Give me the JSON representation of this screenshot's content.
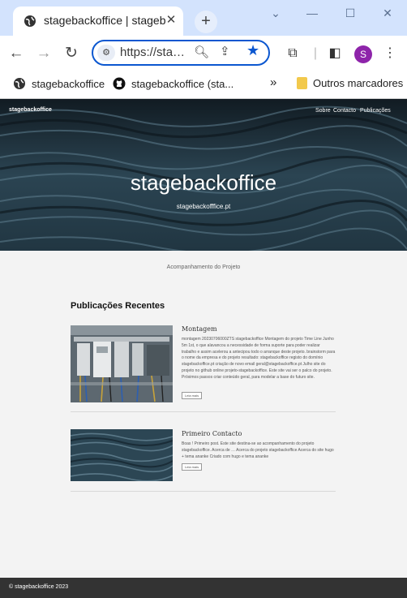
{
  "browser": {
    "tab_title": "stagebackoffice | stagebackoffice",
    "url": "https://stagebackoffice.pt",
    "profile_initial": "S",
    "bookmarks": [
      {
        "label": "stagebackoffice"
      },
      {
        "label": "stagebackoffice (sta..."
      }
    ],
    "other_bookmarks": "Outros marcadores"
  },
  "site": {
    "brand": "stagebackoffice",
    "menu": [
      "Sobre",
      "Contacto",
      "Publicações"
    ],
    "hero_title": "stagebackoffice",
    "hero_subtitle": "stagebackofffice.pt",
    "tagline": "Acompanhamento do Projeto",
    "section_title": "Publicações Recentes",
    "posts": [
      {
        "title": "Montagem",
        "excerpt": "montagem 20230706000ZTS stagebackoffice Montagem do projeto Time Line Junho 5m 1st, o que alavancou a necessidade de forma suporte para poder realizar trabalho e assim acelerou a antecipou todo o arranque deste projeto. brainstorm para o nome da empresa e do projeto resultado: stagebackoffice registo do domínio stagebackoffice.pt criação de novo email geral@stagebackoffice.pt Julho site do projeto no github online projeto-stagebackoffice. Este site vai ser o palco do projeto. Próximos passos criar conteúdo geral, para modelar a base do futuro site.",
        "more": "Leia mais"
      },
      {
        "title": "Primeiro Contacto",
        "excerpt": "Boas ! Primeiro post. Este site destina-se ao acompanhamento do projeto stagebackoffice. Acerca de … Acerca do projeto stagebackoffice Acerca do site hugo + tema ananke Criado com hugo e tema ananke",
        "more": "Leia mais"
      }
    ],
    "footer": "© stagebackoffice 2023"
  },
  "colors": {
    "browser_frame": "#d3e3fd",
    "accent": "#0b57d0",
    "avatar": "#8e24aa",
    "page_bg": "#f3f3f3",
    "footer_bg": "#333333"
  }
}
